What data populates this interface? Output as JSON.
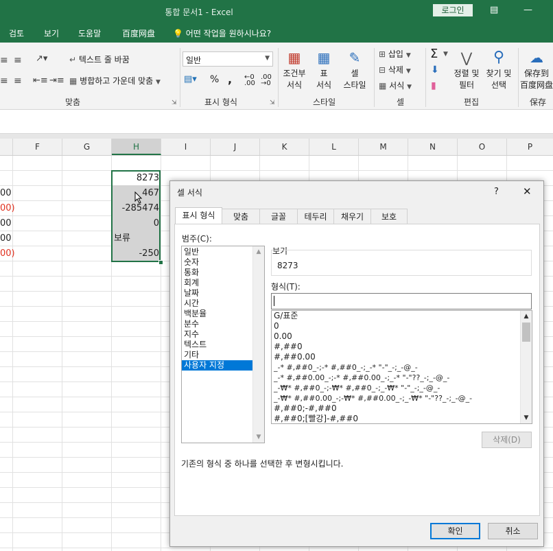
{
  "window": {
    "title": "통합 문서1  -  Excel",
    "login_label": "로그인"
  },
  "ribbon_tabs": [
    "검토",
    "보기",
    "도움말",
    "百度网盘",
    "어떤 작업을 원하시나요?"
  ],
  "ribbon": {
    "wrap_text": "텍스트 줄 바꿈",
    "merge_center": "병합하고 가운데 맞춤",
    "number_format_value": "일반",
    "percent": "%",
    "comma": ",",
    "dec_increase": "←0\n.00",
    "dec_decrease": ".00\n→0",
    "cond_format": [
      "조건부",
      "서식"
    ],
    "table_format": [
      "표",
      "서식"
    ],
    "cell_style": [
      "셀",
      "스타일"
    ],
    "insert": "삽입",
    "delete": "삭제",
    "format": "서식",
    "sort_filter": [
      "정렬 및",
      "필터"
    ],
    "find_select": [
      "찾기 및",
      "선택"
    ],
    "save_baidu": [
      "保存到",
      "百度网盘"
    ],
    "groups": {
      "align": "맞춤",
      "number": "표시 형식",
      "style": "스타일",
      "cells": "셀",
      "edit": "편집",
      "save": "保存"
    }
  },
  "columns": [
    "F",
    "G",
    "H",
    "I",
    "J",
    "K",
    "L",
    "M",
    "N",
    "O",
    "P"
  ],
  "left_partial": [
    {
      "text": "00",
      "color": "#222222"
    },
    {
      "text": "00)",
      "color": "#e0301e"
    },
    {
      "text": "00",
      "color": "#222222"
    },
    {
      "text": "00",
      "color": "#222222"
    },
    {
      "text": "00)",
      "color": "#e0301e"
    }
  ],
  "h_cells": [
    "8273",
    "467",
    "-285474",
    "0",
    "보류",
    "-250"
  ],
  "dialog": {
    "title": "셀 서식",
    "help": "?",
    "close": "✕",
    "tabs": [
      "표시 형식",
      "맞춤",
      "글꼴",
      "테두리",
      "채우기",
      "보호"
    ],
    "category_label": "범주(C):",
    "categories": [
      "일반",
      "숫자",
      "통화",
      "회계",
      "날짜",
      "시간",
      "백분율",
      "분수",
      "지수",
      "텍스트",
      "기타",
      "사용자 지정"
    ],
    "selected_category": "사용자 지정",
    "sample_label": "보기",
    "sample_value": "8273",
    "type_label": "형식(T):",
    "type_value": "",
    "formats": [
      "G/표준",
      "0",
      "0.00",
      "#,##0",
      "#,##0.00",
      "_-* #,##0_-;-* #,##0_-;_-* \"-\"_-;_-@_-",
      "_-* #,##0.00_-;-* #,##0.00_-;_-* \"-\"??_-;_-@_-",
      "_-₩* #,##0_-;-₩* #,##0_-;_-₩* \"-\"_-;_-@_-",
      "_-₩* #,##0.00_-;-₩* #,##0.00_-;_-₩* \"-\"??_-;_-@_-",
      "#,##0;-#,##0",
      "#,##0;[빨강]-#,##0"
    ],
    "delete_label": "삭제(D)",
    "hint": "기존의 형식 중 하나를 선택한 후 변형시킵니다.",
    "ok_label": "확인",
    "cancel_label": "취소"
  },
  "colors": {
    "excel_green": "#217346",
    "selection_blue": "#0078d7",
    "negative_red": "#e0301e"
  }
}
